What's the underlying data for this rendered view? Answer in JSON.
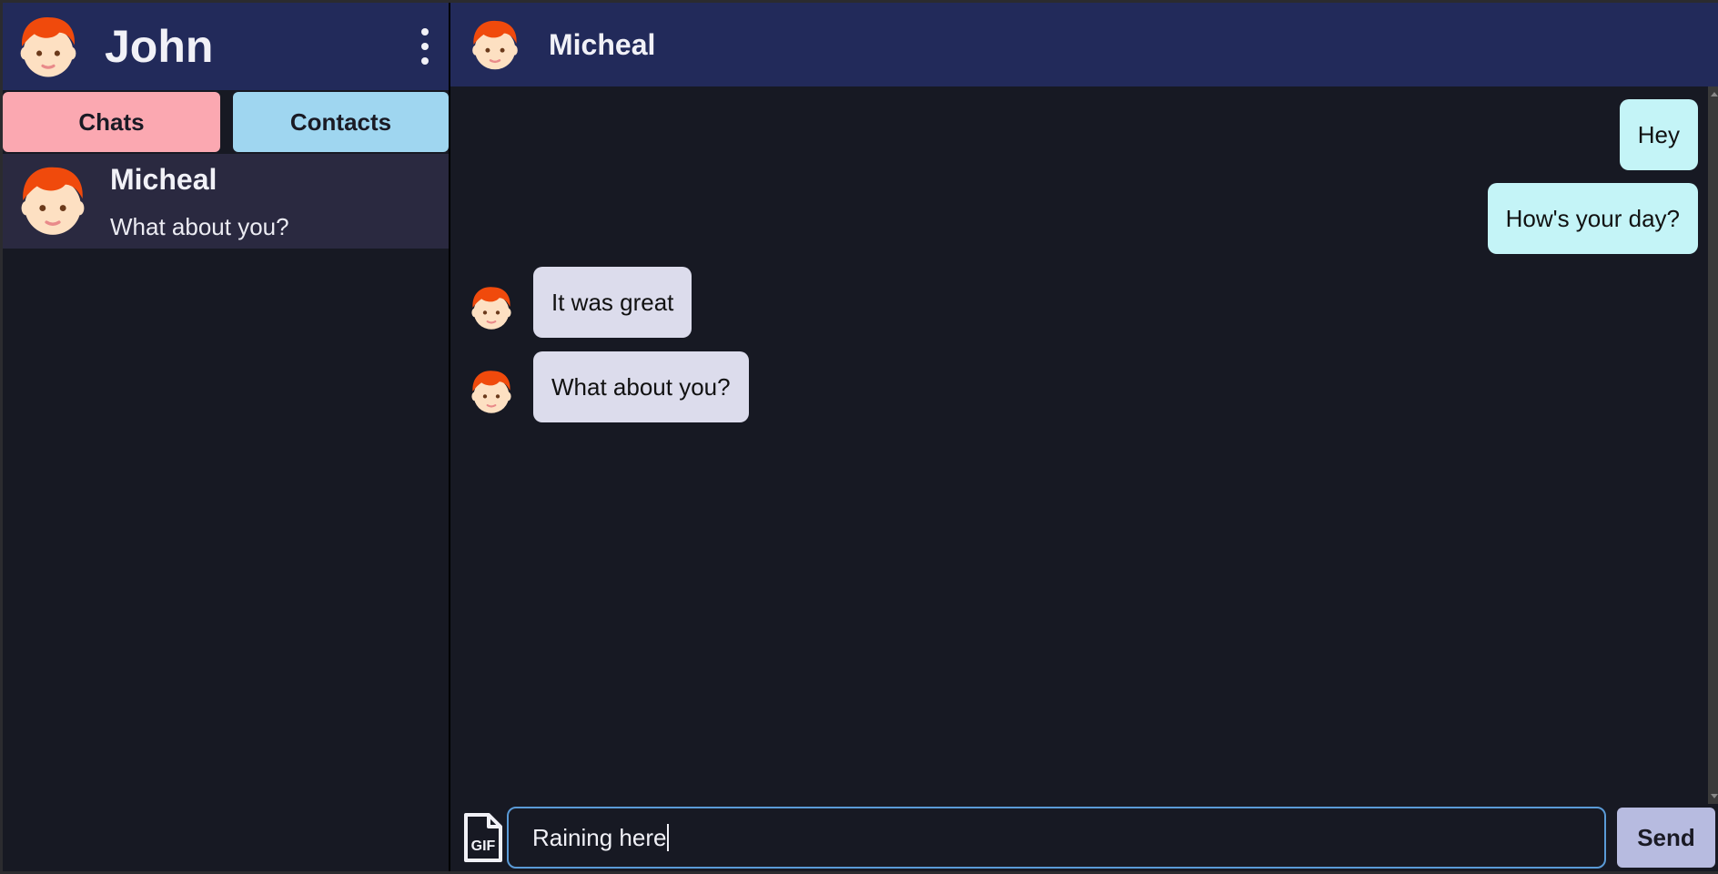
{
  "user": {
    "name": "John",
    "avatar_icon": "red-haired-person-icon"
  },
  "menu_icon": "kebab-menu-icon",
  "tabs": {
    "chats": "Chats",
    "contacts": "Contacts"
  },
  "chat_list": [
    {
      "name": "Micheal",
      "preview": "What about you?"
    }
  ],
  "conversation": {
    "contact_name": "Micheal",
    "messages": [
      {
        "text": "Hey",
        "direction": "out"
      },
      {
        "text": "How's your day?",
        "direction": "out"
      },
      {
        "text": "It was great",
        "direction": "in"
      },
      {
        "text": "What about you?",
        "direction": "in"
      }
    ]
  },
  "composer": {
    "gif_icon": "gif-file-icon",
    "gif_label": "GIF",
    "value": "Raining here",
    "send_label": "Send"
  },
  "colors": {
    "header_bg": "#222a5a",
    "chats_tab": "#fba8b1",
    "contacts_tab": "#9fd6f0",
    "outgoing_bubble": "#c4f4f7",
    "incoming_bubble": "#dcdcec",
    "send_button": "#b7bbe0"
  }
}
